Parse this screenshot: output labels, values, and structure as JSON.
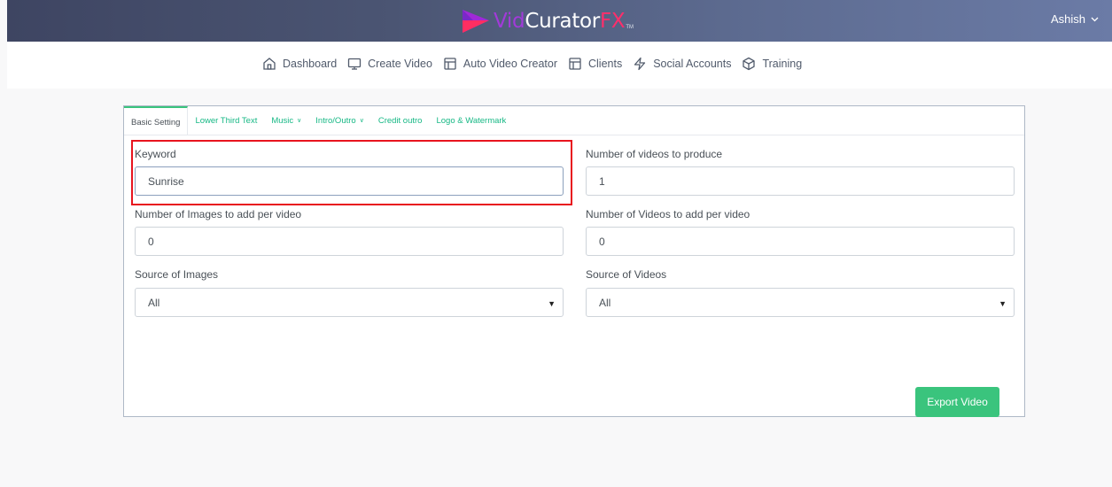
{
  "header": {
    "logo": {
      "part1": "Vid",
      "part2": "Curator",
      "part3": "FX",
      "tm": "TM"
    },
    "user": {
      "name": "Ashish",
      "icon": "chevron-down-icon"
    }
  },
  "nav": {
    "items": [
      {
        "label": "Dashboard",
        "icon": "home-icon"
      },
      {
        "label": "Create Video",
        "icon": "monitor-icon"
      },
      {
        "label": "Auto Video Creator",
        "icon": "layout-icon"
      },
      {
        "label": "Clients",
        "icon": "layout-icon"
      },
      {
        "label": "Social Accounts",
        "icon": "zap-icon"
      },
      {
        "label": "Training",
        "icon": "box-icon"
      }
    ]
  },
  "tabs": [
    {
      "label": "Basic Setting",
      "active": true
    },
    {
      "label": "Lower Third Text"
    },
    {
      "label": "Music",
      "dropdown": true
    },
    {
      "label": "Intro/Outro",
      "dropdown": true
    },
    {
      "label": "Credit outro"
    },
    {
      "label": "Logo & Watermark"
    }
  ],
  "form": {
    "keyword_label": "Keyword",
    "keyword_value": "Sunrise",
    "num_videos_label": "Number of videos to produce",
    "num_videos_value": "1",
    "images_per_video_label": "Number of Images to add per video",
    "images_per_video_value": "0",
    "videos_per_video_label": "Number of Videos to add per video",
    "videos_per_video_value": "0",
    "source_images_label": "Source of Images",
    "source_images_value": "All",
    "source_videos_label": "Source of Videos",
    "source_videos_value": "All"
  },
  "export_button": "Export Video",
  "colors": {
    "accent": "#3ac47d",
    "tab_text": "#17b885",
    "highlight": "#e8141e"
  }
}
